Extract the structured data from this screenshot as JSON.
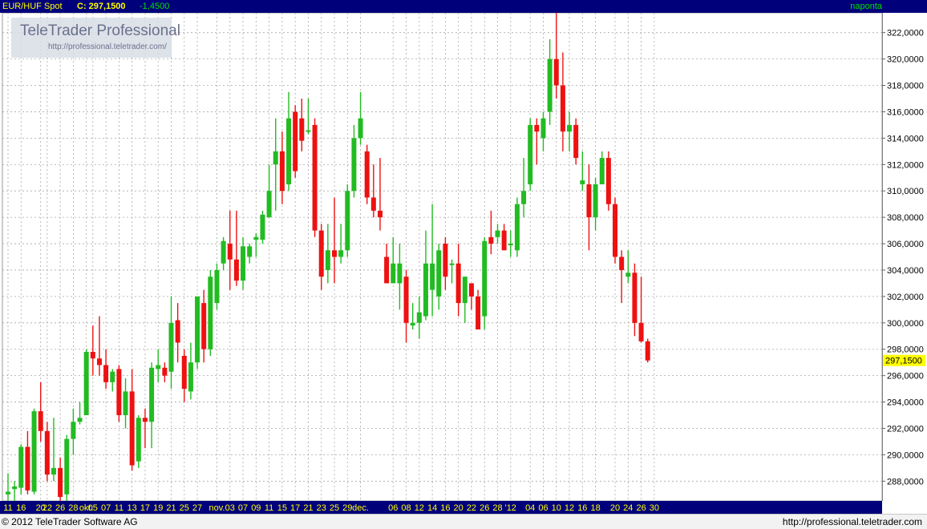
{
  "header": {
    "instrument": "EUR/HUF Spot",
    "close_label": "C: 297,1500",
    "change": "-1,4500",
    "period": "naponta"
  },
  "watermark": {
    "title": "TeleTrader Professional",
    "url": "http://professional.teletrader.com/"
  },
  "footer": {
    "copyright": "© 2012 TeleTrader Software AG",
    "url": "http://professional.teletrader.com"
  },
  "colors": {
    "up": "#22bb22",
    "down": "#ee1111",
    "header_bg": "#00007a",
    "axis_bg": "#00007a",
    "last_price_bg": "#ffff00"
  },
  "chart_data": {
    "type": "candlestick",
    "title": "EUR/HUF Spot",
    "period": "naponta",
    "last_value_label": "297,1500",
    "ylim": [
      286.5,
      323.5
    ],
    "y_ticks": [
      "288,0000",
      "290,0000",
      "292,0000",
      "294,0000",
      "296,0000",
      "298,0000",
      "300,0000",
      "302,0000",
      "304,0000",
      "306,0000",
      "308,0000",
      "310,0000",
      "312,0000",
      "314,0000",
      "316,0000",
      "318,0000",
      "320,0000",
      "322,0000"
    ],
    "x_ticks": [
      "11",
      "16",
      "20",
      "22",
      "26",
      "28",
      "okt.",
      "05",
      "07",
      "11",
      "13",
      "17",
      "19",
      "21",
      "25",
      "27",
      "nov.",
      "03",
      "07",
      "09",
      "11",
      "15",
      "17",
      "21",
      "23",
      "25",
      "29",
      "dec.",
      "06",
      "08",
      "12",
      "14",
      "16",
      "20",
      "22",
      "26",
      "28",
      "'12",
      "04",
      "06",
      "10",
      "12",
      "16",
      "18",
      "20",
      "24",
      "26",
      "30"
    ],
    "grid": true,
    "candles": [
      {
        "o": 287.0,
        "h": 288.6,
        "l": 286.5,
        "c": 287.2
      },
      {
        "o": 287.4,
        "h": 288.0,
        "l": 286.5,
        "c": 287.6
      },
      {
        "o": 287.5,
        "h": 290.8,
        "l": 287.0,
        "c": 290.6
      },
      {
        "o": 290.6,
        "h": 291.8,
        "l": 287.0,
        "c": 287.3
      },
      {
        "o": 287.2,
        "h": 293.5,
        "l": 287.0,
        "c": 293.3
      },
      {
        "o": 293.3,
        "h": 295.5,
        "l": 291.0,
        "c": 291.8
      },
      {
        "o": 291.8,
        "h": 292.5,
        "l": 288.0,
        "c": 288.5
      },
      {
        "o": 288.5,
        "h": 292.8,
        "l": 288.0,
        "c": 289.0
      },
      {
        "o": 289.0,
        "h": 289.8,
        "l": 286.5,
        "c": 286.8
      },
      {
        "o": 287.0,
        "h": 291.5,
        "l": 286.5,
        "c": 291.2
      },
      {
        "o": 291.2,
        "h": 293.5,
        "l": 290.0,
        "c": 292.5
      },
      {
        "o": 292.5,
        "h": 294.0,
        "l": 292.3,
        "c": 292.8
      },
      {
        "o": 293.0,
        "h": 298.0,
        "l": 293.0,
        "c": 297.8
      },
      {
        "o": 297.8,
        "h": 299.8,
        "l": 296.0,
        "c": 297.3
      },
      {
        "o": 297.3,
        "h": 300.5,
        "l": 296.0,
        "c": 296.8
      },
      {
        "o": 296.8,
        "h": 298.0,
        "l": 295.0,
        "c": 295.5
      },
      {
        "o": 295.5,
        "h": 296.5,
        "l": 294.8,
        "c": 296.3
      },
      {
        "o": 296.5,
        "h": 296.8,
        "l": 292.5,
        "c": 293.0
      },
      {
        "o": 293.0,
        "h": 295.8,
        "l": 292.0,
        "c": 294.8
      },
      {
        "o": 294.8,
        "h": 296.5,
        "l": 288.8,
        "c": 289.2
      },
      {
        "o": 289.5,
        "h": 293.0,
        "l": 289.0,
        "c": 292.8
      },
      {
        "o": 292.8,
        "h": 293.5,
        "l": 290.5,
        "c": 292.5
      },
      {
        "o": 292.5,
        "h": 297.0,
        "l": 290.5,
        "c": 296.6
      },
      {
        "o": 296.5,
        "h": 298.0,
        "l": 295.5,
        "c": 296.8
      },
      {
        "o": 296.6,
        "h": 297.0,
        "l": 295.5,
        "c": 296.0
      },
      {
        "o": 296.3,
        "h": 302.0,
        "l": 295.0,
        "c": 300.0
      },
      {
        "o": 300.2,
        "h": 301.5,
        "l": 297.0,
        "c": 298.5
      },
      {
        "o": 297.5,
        "h": 298.0,
        "l": 294.0,
        "c": 295.0
      },
      {
        "o": 294.8,
        "h": 298.5,
        "l": 294.2,
        "c": 297.0
      },
      {
        "o": 297.0,
        "h": 302.0,
        "l": 296.5,
        "c": 302.0
      },
      {
        "o": 301.5,
        "h": 302.5,
        "l": 297.0,
        "c": 298.0
      },
      {
        "o": 298.0,
        "h": 304.0,
        "l": 297.5,
        "c": 303.5
      },
      {
        "o": 301.5,
        "h": 304.5,
        "l": 301.0,
        "c": 304.0
      },
      {
        "o": 304.5,
        "h": 306.5,
        "l": 304.0,
        "c": 306.2
      },
      {
        "o": 306.0,
        "h": 308.5,
        "l": 302.5,
        "c": 304.8
      },
      {
        "o": 304.8,
        "h": 308.5,
        "l": 302.8,
        "c": 303.2
      },
      {
        "o": 303.2,
        "h": 306.5,
        "l": 302.5,
        "c": 305.8
      },
      {
        "o": 305.0,
        "h": 306.0,
        "l": 304.5,
        "c": 305.8
      },
      {
        "o": 306.3,
        "h": 306.8,
        "l": 305.0,
        "c": 306.5
      },
      {
        "o": 306.3,
        "h": 308.5,
        "l": 306.0,
        "c": 308.2
      },
      {
        "o": 308.0,
        "h": 312.0,
        "l": 308.0,
        "c": 310.0
      },
      {
        "o": 312.0,
        "h": 315.5,
        "l": 308.5,
        "c": 313.0
      },
      {
        "o": 313.0,
        "h": 314.5,
        "l": 309.0,
        "c": 310.0
      },
      {
        "o": 310.5,
        "h": 317.5,
        "l": 310.0,
        "c": 315.5
      },
      {
        "o": 316.0,
        "h": 316.5,
        "l": 311.0,
        "c": 311.5
      },
      {
        "o": 315.5,
        "h": 317.0,
        "l": 313.0,
        "c": 313.8
      },
      {
        "o": 314.5,
        "h": 317.0,
        "l": 314.3,
        "c": 314.6
      },
      {
        "o": 315.0,
        "h": 315.5,
        "l": 306.5,
        "c": 307.0
      },
      {
        "o": 307.0,
        "h": 307.5,
        "l": 302.5,
        "c": 303.5
      },
      {
        "o": 304.0,
        "h": 307.5,
        "l": 303.0,
        "c": 305.5
      },
      {
        "o": 305.5,
        "h": 309.5,
        "l": 303.0,
        "c": 305.0
      },
      {
        "o": 305.0,
        "h": 307.5,
        "l": 304.5,
        "c": 305.5
      },
      {
        "o": 305.5,
        "h": 310.5,
        "l": 305.0,
        "c": 310.0
      },
      {
        "o": 310.0,
        "h": 315.0,
        "l": 309.5,
        "c": 314.0
      },
      {
        "o": 314.0,
        "h": 317.5,
        "l": 313.5,
        "c": 315.5
      },
      {
        "o": 313.0,
        "h": 313.5,
        "l": 309.0,
        "c": 309.5
      },
      {
        "o": 309.5,
        "h": 312.0,
        "l": 308.0,
        "c": 308.5
      },
      {
        "o": 308.5,
        "h": 312.5,
        "l": 307.0,
        "c": 308.0
      },
      {
        "o": 305.0,
        "h": 306.0,
        "l": 303.0,
        "c": 303.0
      },
      {
        "o": 303.0,
        "h": 306.5,
        "l": 303.0,
        "c": 304.5
      },
      {
        "o": 303.0,
        "h": 306.0,
        "l": 301.0,
        "c": 304.5
      },
      {
        "o": 303.5,
        "h": 304.0,
        "l": 298.5,
        "c": 300.0
      },
      {
        "o": 299.8,
        "h": 301.5,
        "l": 299.5,
        "c": 300.0
      },
      {
        "o": 300.0,
        "h": 302.0,
        "l": 298.8,
        "c": 300.8
      },
      {
        "o": 300.5,
        "h": 307.0,
        "l": 300.2,
        "c": 304.5
      },
      {
        "o": 302.5,
        "h": 309.0,
        "l": 300.5,
        "c": 304.5
      },
      {
        "o": 302.0,
        "h": 306.0,
        "l": 301.0,
        "c": 305.5
      },
      {
        "o": 306.0,
        "h": 306.5,
        "l": 302.5,
        "c": 303.5
      },
      {
        "o": 304.5,
        "h": 304.8,
        "l": 303.0,
        "c": 304.5
      },
      {
        "o": 304.5,
        "h": 306.0,
        "l": 300.5,
        "c": 301.5
      },
      {
        "o": 301.5,
        "h": 303.5,
        "l": 300.0,
        "c": 303.5
      },
      {
        "o": 303.0,
        "h": 303.0,
        "l": 301.0,
        "c": 302.0
      },
      {
        "o": 302.0,
        "h": 302.5,
        "l": 299.5,
        "c": 299.5
      },
      {
        "o": 300.5,
        "h": 306.5,
        "l": 299.5,
        "c": 306.2
      },
      {
        "o": 306.5,
        "h": 308.5,
        "l": 305.2,
        "c": 306.0
      },
      {
        "o": 306.5,
        "h": 307.5,
        "l": 306.0,
        "c": 307.0
      },
      {
        "o": 307.0,
        "h": 307.5,
        "l": 305.5,
        "c": 305.5
      },
      {
        "o": 306.0,
        "h": 307.0,
        "l": 305.0,
        "c": 306.0
      },
      {
        "o": 305.5,
        "h": 309.5,
        "l": 305.0,
        "c": 309.0
      },
      {
        "o": 309.0,
        "h": 312.5,
        "l": 308.0,
        "c": 310.0
      },
      {
        "o": 310.5,
        "h": 315.5,
        "l": 310.0,
        "c": 315.0
      },
      {
        "o": 315.0,
        "h": 315.5,
        "l": 312.0,
        "c": 314.5
      },
      {
        "o": 314.0,
        "h": 316.0,
        "l": 313.0,
        "c": 315.5
      },
      {
        "o": 316.0,
        "h": 321.5,
        "l": 315.0,
        "c": 320.0
      },
      {
        "o": 320.0,
        "h": 323.5,
        "l": 317.0,
        "c": 318.0
      },
      {
        "o": 318.0,
        "h": 320.5,
        "l": 313.0,
        "c": 314.5
      },
      {
        "o": 314.5,
        "h": 316.0,
        "l": 313.0,
        "c": 315.0
      },
      {
        "o": 315.0,
        "h": 315.5,
        "l": 312.0,
        "c": 312.5
      },
      {
        "o": 310.5,
        "h": 313.0,
        "l": 310.0,
        "c": 310.8
      },
      {
        "o": 310.5,
        "h": 312.0,
        "l": 305.5,
        "c": 308.0
      },
      {
        "o": 308.0,
        "h": 311.0,
        "l": 307.0,
        "c": 310.5
      },
      {
        "o": 310.5,
        "h": 313.0,
        "l": 310.5,
        "c": 312.5
      },
      {
        "o": 312.5,
        "h": 313.0,
        "l": 308.5,
        "c": 309.0
      },
      {
        "o": 309.0,
        "h": 309.5,
        "l": 304.5,
        "c": 305.0
      },
      {
        "o": 305.0,
        "h": 305.5,
        "l": 301.5,
        "c": 304.0
      },
      {
        "o": 303.5,
        "h": 305.5,
        "l": 303.0,
        "c": 303.8
      },
      {
        "o": 303.8,
        "h": 304.5,
        "l": 299.0,
        "c": 300.0
      },
      {
        "o": 300.0,
        "h": 303.5,
        "l": 298.5,
        "c": 298.6
      },
      {
        "o": 298.6,
        "h": 298.8,
        "l": 297.0,
        "c": 297.15
      }
    ]
  }
}
